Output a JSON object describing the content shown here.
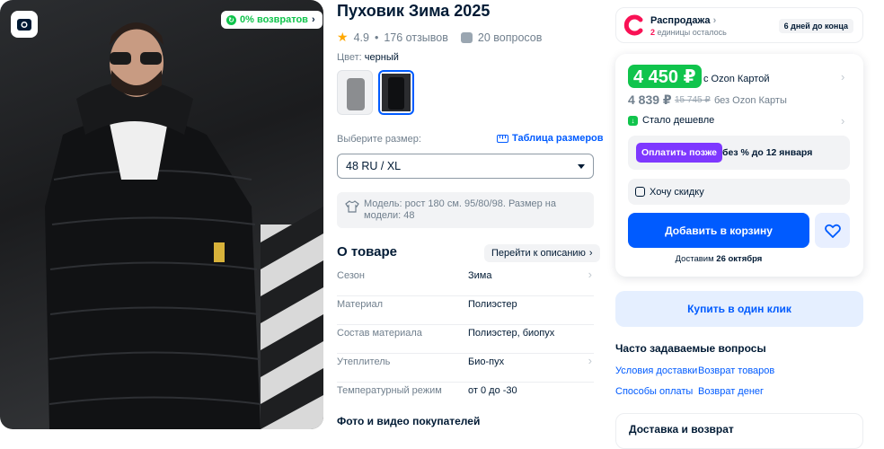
{
  "product": {
    "title": "Пуховик Зима 2025",
    "rating": "4.9",
    "reviews": "176 отзывов",
    "questions": "20 вопросов",
    "color_label": "Цвет:",
    "color_value": "черный",
    "returns_badge": "0% возвратов"
  },
  "size": {
    "label": "Выберите размер:",
    "table_link": "Таблица размеров",
    "selected": "48 RU / XL",
    "model_note": "Модель: рост 180 см. 95/80/98. Размер на модели: 48"
  },
  "about": {
    "title": "О товаре",
    "goto_desc": "Перейти к описанию",
    "specs": [
      {
        "key": "Сезон",
        "value": "Зима"
      },
      {
        "key": "Материал",
        "value": "Полиэстер"
      },
      {
        "key": "Состав материала",
        "value": "Полиэстер, биопух"
      },
      {
        "key": "Утеплитель",
        "value": "Био-пух"
      },
      {
        "key": "Температурный режим",
        "value": "от 0 до -30"
      }
    ],
    "photos_title": "Фото и видео покупателей"
  },
  "sale": {
    "title": "Распродажа",
    "units_count": "2",
    "units_text": "единицы осталось",
    "days_left": "6 дней до конца"
  },
  "price": {
    "card_price": "4 450 ₽",
    "card_label": "с Ozon Картой",
    "regular_price": "4 839 ₽",
    "old_price": "15 745 ₽",
    "no_card_label": "без Ozon Карты",
    "cheaper": "Стало дешевле",
    "pay_later_button": "Оплатить позже",
    "pay_later_text": "без % до 12 января",
    "want_discount": "Хочу скидку",
    "add_to_cart": "Добавить в корзину",
    "delivery_prefix": "Доставим",
    "delivery_date": "26 октября"
  },
  "buy_one_click": "Купить в один клик",
  "faq": {
    "title": "Часто задаваемые вопросы",
    "links": [
      "Условия доставки",
      "Возврат товаров",
      "Способы оплаты",
      "Возврат денег"
    ]
  },
  "bottom_card_title": "Доставка и возврат",
  "colors": {
    "accent": "#005bff",
    "green": "#10c44c",
    "purple": "#7e38ff",
    "sale_pink": "#f91155"
  }
}
